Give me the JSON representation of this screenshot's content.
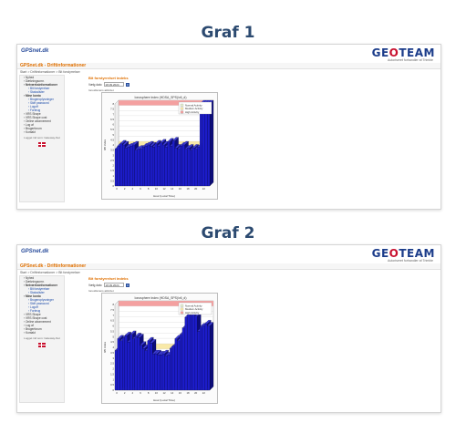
{
  "headings": {
    "graph1": "Graf 1",
    "graph2": "Graf 2"
  },
  "app": {
    "logo_left": "GPSnet.dk",
    "logo_right_a": "GE",
    "logo_right_o": "O",
    "logo_right_b": "TEAM",
    "tagline": "Autoriseret forhandler af Trimble",
    "title": "GPSnet.dk - Driftinformationer",
    "breadcrumb": "Start > Driftinformationer > Bit forstyrrelser",
    "sidebar": [
      {
        "label": "Nyhed",
        "type": "item"
      },
      {
        "label": "Dækningsomr.",
        "type": "item"
      },
      {
        "label": "Netværksinformationer",
        "type": "bold"
      },
      {
        "label": "Bit forstyrrelser",
        "type": "sub"
      },
      {
        "label": "Statuslister",
        "type": "sub"
      },
      {
        "label": "Mine konto",
        "type": "bold"
      },
      {
        "label": "Brugeroplysninger",
        "type": "sub"
      },
      {
        "label": "Skift password",
        "type": "sub"
      },
      {
        "label": "Logoff",
        "type": "sub"
      },
      {
        "label": "Forbrug",
        "type": "sub"
      },
      {
        "label": "VRS Shape",
        "type": "item"
      },
      {
        "label": "VRS Shape cost",
        "type": "item"
      },
      {
        "label": "Online abonnement",
        "type": "item"
      },
      {
        "label": "Log af",
        "type": "item"
      },
      {
        "label": "Brugerforum",
        "type": "item"
      },
      {
        "label": "Kontakt",
        "type": "item"
      }
    ],
    "logout_text": "Logget ind som: Gateway-Net",
    "content_title": "Bit forstyrrelset indeks",
    "date_label": "Vælg dato",
    "date_value": "18.09.2024",
    "selected_label": "Ionosfærens aktivitet"
  },
  "colors": {
    "bar": "#1c1cc8",
    "bar_side": "#0d0d7a",
    "zone_high": "#f4a0a0",
    "zone_medium": "#f8e9a8",
    "zone_normal": "#e6f0d0",
    "accent": "#e07000"
  },
  "chart_data": [
    {
      "type": "bar",
      "title": "Ionosphere Index (HDSA_SPS)/v6_d)",
      "xlabel": "Hour (Local Time)",
      "ylabel": "I95 index",
      "legend": [
        "Normal Activity",
        "Medium Activity",
        "High Activity"
      ],
      "legend_position": "top-right",
      "ylim": [
        0,
        8
      ],
      "yticks": [
        0,
        0.5,
        1,
        1.5,
        2,
        2.5,
        3,
        3.5,
        4,
        4.5,
        5,
        5.5,
        6,
        6.5,
        7,
        7.5,
        8
      ],
      "xticks": [
        0,
        2,
        4,
        6,
        8,
        10,
        12,
        14,
        16,
        18,
        20,
        22
      ],
      "values": [
        3.6,
        3.9,
        4.1,
        4.0,
        3.7,
        3.8,
        3.9,
        4.0,
        3.5,
        3.6,
        3.6,
        3.8,
        3.9,
        4.0,
        3.9,
        3.8,
        4.1,
        3.9,
        4.2,
        4.0,
        3.8,
        4.3,
        3.9,
        4.4,
        3.7,
        3.6,
        3.9,
        4.0,
        3.6,
        3.7,
        3.5,
        3.7,
        3.6,
        3.8,
        8.0,
        8.0,
        8.0,
        8.0
      ]
    },
    {
      "type": "bar",
      "title": "Ionosphere Index (HDSA_SPS)/v6_d)",
      "xlabel": "Hour (Local Time)",
      "ylabel": "I95 index",
      "legend": [
        "Normal Activity",
        "Medium Activity",
        "High Activity"
      ],
      "legend_position": "top-right",
      "ylim": [
        0,
        8
      ],
      "yticks": [
        0,
        0.5,
        1,
        1.5,
        2,
        2.5,
        3,
        3.5,
        4,
        4.5,
        5,
        5.5,
        6,
        6.5,
        7,
        7.5,
        8
      ],
      "xticks": [
        0,
        2,
        4,
        6,
        8,
        10,
        12,
        14,
        16,
        18,
        20,
        22
      ],
      "values": [
        3.7,
        4.8,
        4.6,
        4.9,
        5.1,
        4.5,
        5.2,
        4.8,
        5.0,
        4.9,
        4.2,
        3.9,
        3.7,
        4.6,
        4.4,
        3.4,
        3.4,
        3.3,
        3.3,
        3.4,
        3.2,
        3.3,
        3.9,
        4.1,
        4.8,
        4.6,
        5.2,
        5.8,
        6.8,
        7.4,
        7.0,
        7.6,
        6.9,
        5.5,
        5.9,
        6.0,
        6.2,
        6.0
      ]
    }
  ]
}
